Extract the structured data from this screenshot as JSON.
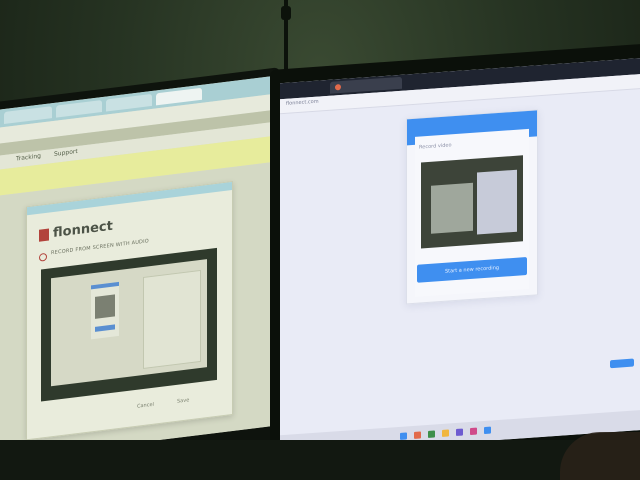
{
  "scene": {
    "left_screen": {
      "nav": [
        "Tracking",
        "Support"
      ],
      "logo": "flonnect",
      "record_option": "RECORD FROM SCREEN WITH AUDIO",
      "buttons": [
        "Cancel",
        "Save"
      ]
    },
    "right_screen": {
      "address": "flonnect.com",
      "card_title": "Record video",
      "card_button": "Start a new recording"
    }
  }
}
